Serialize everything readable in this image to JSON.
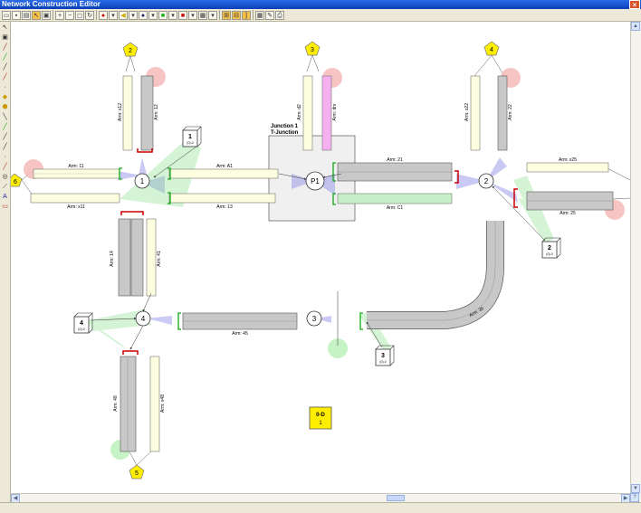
{
  "window": {
    "title": "Network Construction Editor",
    "close": "×"
  },
  "toolbar": {
    "icons": [
      "open-icon",
      "save-icon",
      "print-icon",
      "select-icon",
      "zoom-in-icon",
      "zoom-out-icon",
      "zoom-fit-icon",
      "refresh-icon",
      "signal-icon",
      "arrow-icon",
      "detector-icon",
      "node-icon",
      "controller-icon",
      "grid-icon",
      "snap-icon",
      "bracket-icon",
      "table-icon",
      "pencil-icon",
      "export-icon"
    ]
  },
  "junction": {
    "title": "Junction 1",
    "type": "T-Junction",
    "label": "P1"
  },
  "nodes": {
    "n1": "1",
    "n2": "2",
    "n3": "3",
    "n4": "4"
  },
  "zones": {
    "z1": "1",
    "z2": "2",
    "z3": "3",
    "z4": "4"
  },
  "zone_sub": "(0)-0",
  "pentagons": {
    "p2": "2",
    "p3": "3",
    "p4": "4",
    "p6": "6",
    "p5": "5"
  },
  "arms": {
    "a11": "Arm: 11",
    "ax11": "Arm: x11",
    "aA1": "Arm: A1",
    "a13": "Arm: 13",
    "a21": "Arm: 21",
    "aC1": "Arm: C1",
    "ax25": "Arm: x25",
    "a25": "Arm: 25",
    "a45": "Arm: 45",
    "a35": "Arm: 35",
    "ax12": "Arm: x12",
    "a12": "Arm: 12",
    "ax22": "Arm: x22",
    "a22": "Arm: 22",
    "ad2": "Arm: d2",
    "adrv": "Arm: drv",
    "a48": "Arm: 48",
    "ax48": "Arm: x48",
    "a14": "Arm: 14",
    "a41": "Arm: 41"
  },
  "legend": {
    "title": "0-D",
    "value": "1"
  },
  "scroll": {
    "up": "▲",
    "down": "▼",
    "left": "◀",
    "right": "▶",
    "help": "?"
  }
}
